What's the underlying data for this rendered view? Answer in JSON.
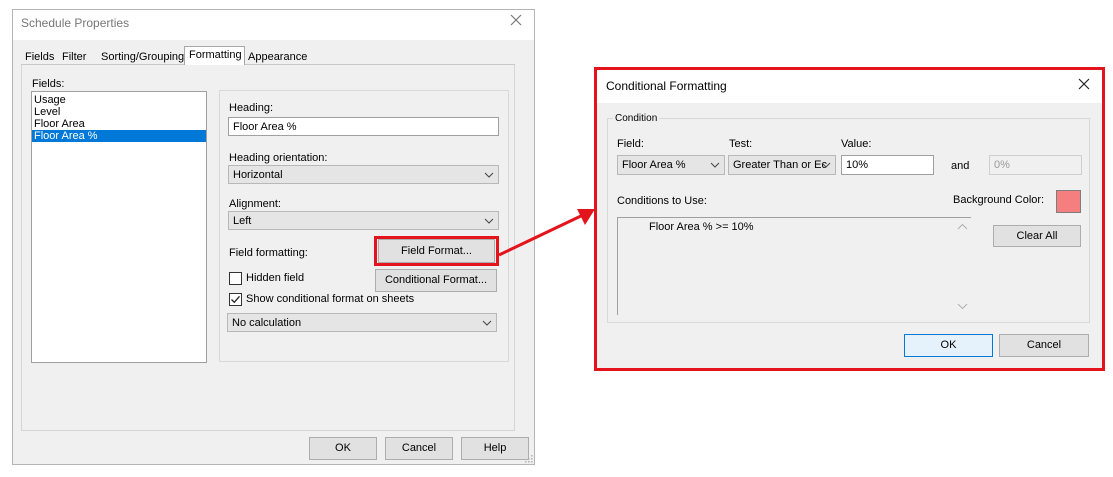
{
  "schedule_dialog": {
    "title": "Schedule Properties",
    "tabs": [
      "Fields",
      "Filter",
      "Sorting/Grouping",
      "Formatting",
      "Appearance"
    ],
    "active_tab": "Formatting",
    "fields_label": "Fields:",
    "fields": [
      "Usage",
      "Level",
      "Floor Area",
      "Floor Area %"
    ],
    "selected_field": "Floor Area %",
    "heading_label": "Heading:",
    "heading_value": "Floor Area %",
    "heading_orientation_label": "Heading orientation:",
    "heading_orientation_value": "Horizontal",
    "alignment_label": "Alignment:",
    "alignment_value": "Left",
    "field_formatting_label": "Field formatting:",
    "field_format_button": "Field Format...",
    "hidden_field_label": "Hidden field",
    "hidden_field_checked": false,
    "conditional_format_button": "Conditional  Format...",
    "show_conditional_label": "Show conditional format on sheets",
    "show_conditional_checked": true,
    "calculation_value": "No calculation",
    "ok_button": "OK",
    "cancel_button": "Cancel",
    "help_button": "Help"
  },
  "conditional_dialog": {
    "title": "Conditional Formatting",
    "condition_group_label": "Condition",
    "field_label": "Field:",
    "field_value": "Floor Area %",
    "test_label": "Test:",
    "test_value": "Greater Than or Ec",
    "value_label": "Value:",
    "value_value": "10%",
    "and_label": "and",
    "and_value": "0%",
    "conditions_to_use_label": "Conditions to Use:",
    "conditions": [
      "Floor Area % >= 10%"
    ],
    "background_color_label": "Background Color:",
    "background_color": "#f57f7f",
    "clear_all_button": "Clear All",
    "ok_button": "OK",
    "cancel_button": "Cancel"
  },
  "colors": {
    "highlight_red": "#e3141c",
    "selection_blue": "#0078d7"
  }
}
